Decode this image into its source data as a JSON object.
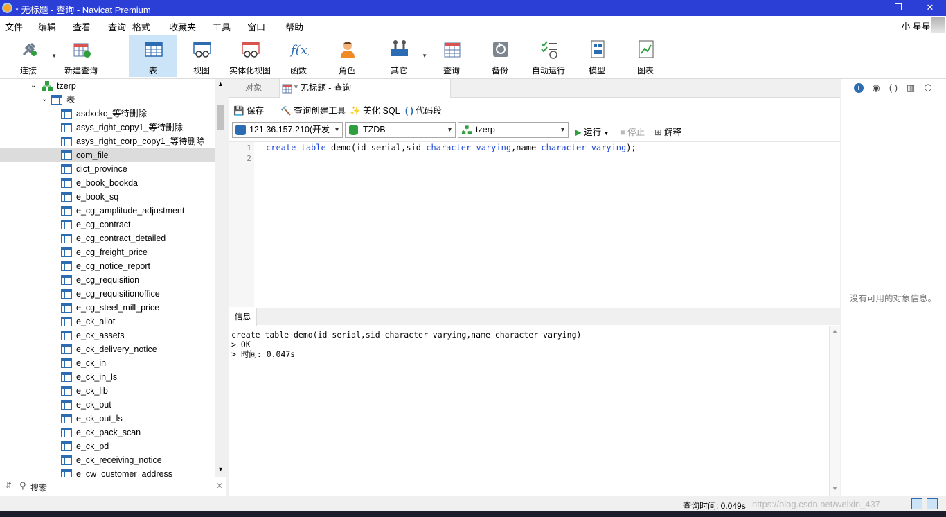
{
  "window": {
    "title": "* 无标题 - 查询 - Navicat Premium",
    "minimize": "—",
    "maximize": "❐",
    "close": "✕"
  },
  "menu": {
    "items": [
      "文件",
      "编辑",
      "查看",
      "查询",
      "格式",
      "收藏夹",
      "工具",
      "窗口",
      "帮助"
    ],
    "user": "小 星星"
  },
  "toolbar": {
    "items": [
      {
        "label": "连接",
        "icon": "plug-icon"
      },
      {
        "label": "新建查询",
        "icon": "new-query-icon"
      },
      {
        "label": "表",
        "icon": "table-icon"
      },
      {
        "label": "视图",
        "icon": "view-icon"
      },
      {
        "label": "实体化视图",
        "icon": "materialized-view-icon"
      },
      {
        "label": "函数",
        "icon": "function-icon"
      },
      {
        "label": "角色",
        "icon": "role-icon"
      },
      {
        "label": "其它",
        "icon": "tools-icon"
      },
      {
        "label": "查询",
        "icon": "query-icon"
      },
      {
        "label": "备份",
        "icon": "backup-icon"
      },
      {
        "label": "自动运行",
        "icon": "automation-icon"
      },
      {
        "label": "模型",
        "icon": "model-icon"
      },
      {
        "label": "图表",
        "icon": "chart-icon"
      }
    ]
  },
  "sidebar": {
    "schema": "tzerp",
    "tables_folder": "表",
    "tables": [
      "asdxckc_等待删除",
      "asys_right_copy1_等待删除",
      "asys_right_corp_copy1_等待删除",
      "com_file",
      "dict_province",
      "e_book_bookda",
      "e_book_sq",
      "e_cg_amplitude_adjustment",
      "e_cg_contract",
      "e_cg_contract_detailed",
      "e_cg_freight_price",
      "e_cg_notice_report",
      "e_cg_requisition",
      "e_cg_requisitionoffice",
      "e_cg_steel_mill_price",
      "e_ck_allot",
      "e_ck_assets",
      "e_ck_delivery_notice",
      "e_ck_in",
      "e_ck_in_ls",
      "e_ck_lib",
      "e_ck_out",
      "e_ck_out_ls",
      "e_ck_pack_scan",
      "e_ck_pd",
      "e_ck_receiving_notice",
      "e_cw_customer_address"
    ],
    "selected": "com_file",
    "search_placeholder": "搜索"
  },
  "tabs": {
    "objects": "对象",
    "query": "* 无标题 - 查询"
  },
  "query_toolbar": {
    "save": "保存",
    "builder": "查询创建工具",
    "beautify": "美化 SQL",
    "snippet": "代码段"
  },
  "selectors": {
    "connection": "121.36.157.210(开发",
    "database": "TZDB",
    "schema": "tzerp",
    "run": "运行",
    "stop": "停止",
    "explain": "解释"
  },
  "editor": {
    "line_numbers": [
      "1",
      "2"
    ],
    "code_line1": [
      "create",
      " ",
      "table",
      " demo(id serial,sid ",
      "character",
      " ",
      "varying",
      ",name ",
      "character",
      " ",
      "varying",
      ");"
    ]
  },
  "info": {
    "tab": "信息",
    "output": "create table demo(id serial,sid character varying,name character varying)\n> OK\n> 时间: 0.047s"
  },
  "right_panel": {
    "empty_text": "没有可用的对象信息。"
  },
  "status": {
    "query_time": "查询时间: 0.049s",
    "watermark": "https://blog.csdn.net/weixin_437"
  }
}
